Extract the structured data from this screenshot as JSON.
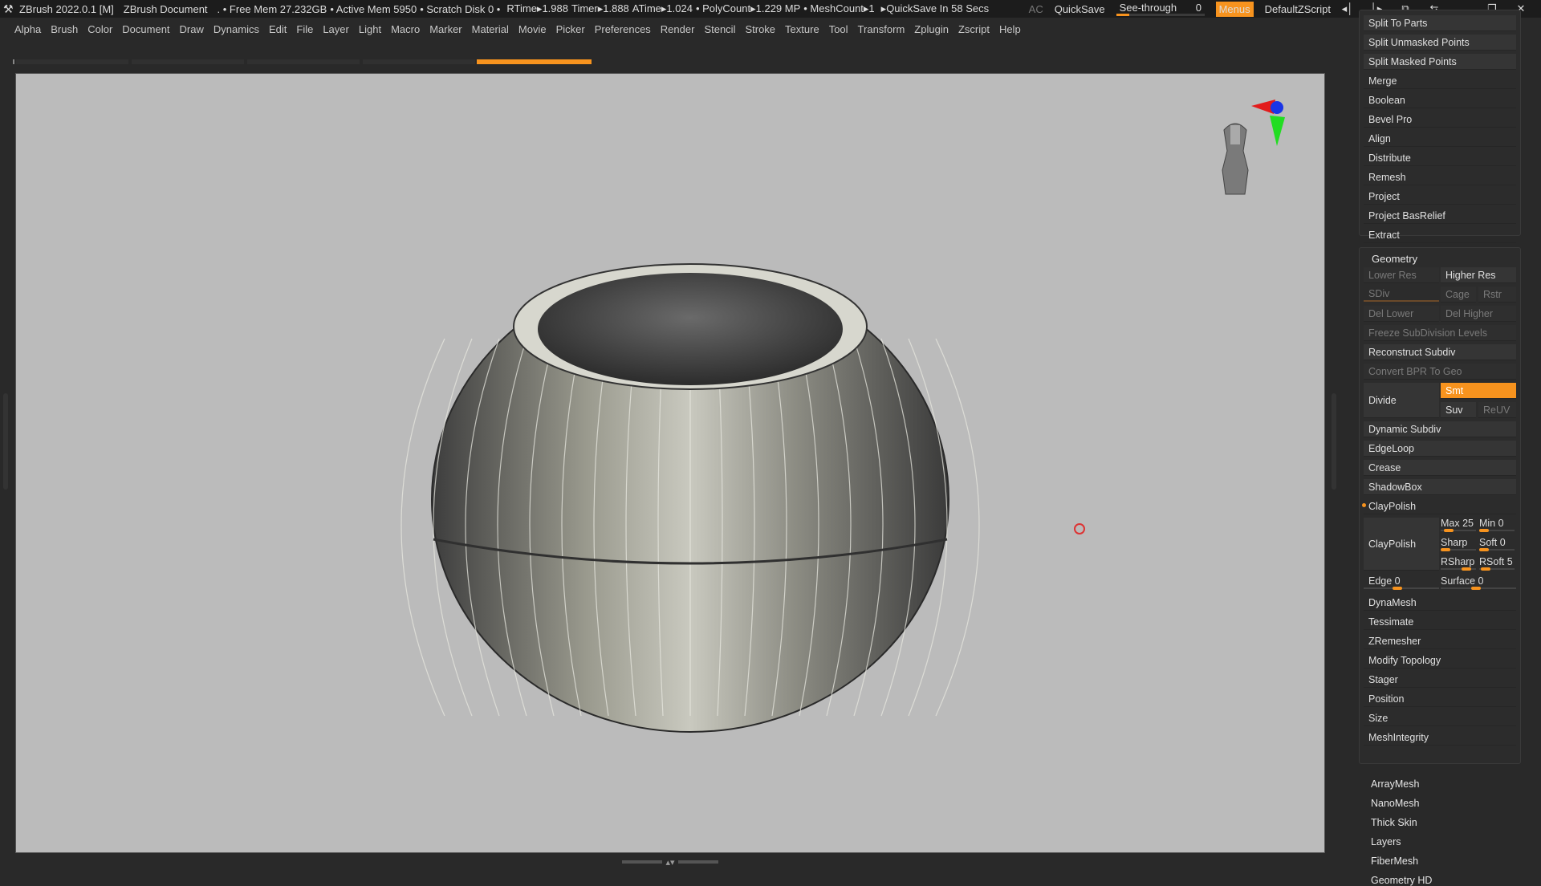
{
  "titlebar": {
    "app": "ZBrush 2022.0.1 [M]",
    "document": "ZBrush Document",
    "free_mem": ". • Free Mem 27.232GB",
    "active_mem": "• Active Mem 5950",
    "scratch": "• Scratch Disk 0 •",
    "rtime": "RTime▸1.988",
    "timer": "Timer▸1.888",
    "atime": "ATime▸1.024",
    "polycount": "• PolyCount▸1.229 MP",
    "meshcount": "• MeshCount▸1",
    "quicksave_in": "▸QuickSave In 58 Secs",
    "ac": "AC",
    "quicksave": "QuickSave",
    "seethrough_label": "See-through",
    "seethrough_value": "0",
    "menus": "Menus",
    "script": "DefaultZScript"
  },
  "menu": [
    "Alpha",
    "Brush",
    "Color",
    "Document",
    "Draw",
    "Dynamics",
    "Edit",
    "File",
    "Layer",
    "Light",
    "Macro",
    "Marker",
    "Material",
    "Movie",
    "Picker",
    "Preferences",
    "Render",
    "Stencil",
    "Stroke",
    "Texture",
    "Tool",
    "Transform",
    "Zplugin",
    "Zscript",
    "Help"
  ],
  "subtool_buttons": [
    "Split To Parts",
    "Split Unmasked Points",
    "Split Masked Points",
    "Merge",
    "Boolean",
    "Bevel Pro",
    "Align",
    "Distribute",
    "Remesh",
    "Project",
    "Project BasRelief",
    "Extract"
  ],
  "geometry": {
    "title": "Geometry",
    "lower_res": "Lower Res",
    "higher_res": "Higher Res",
    "sdiv": "SDiv",
    "cage": "Cage",
    "rstr": "Rstr",
    "del_lower": "Del Lower",
    "del_higher": "Del Higher",
    "freeze": "Freeze SubDivision Levels",
    "reconstruct": "Reconstruct Subdiv",
    "convert_bpr": "Convert BPR To Geo",
    "divide": "Divide",
    "smt": "Smt",
    "suv": "Suv",
    "reuv": "ReUV",
    "dynamic_subdiv": "Dynamic Subdiv",
    "edgeloop": "EdgeLoop",
    "crease": "Crease",
    "shadowbox": "ShadowBox",
    "claypolish_header": "ClayPolish",
    "claypolish_btn": "ClayPolish",
    "max": "Max 25",
    "min": "Min 0",
    "sharp": "Sharp",
    "soft": "Soft 0",
    "rsharp": "RSharp",
    "rsoft": "RSoft 5",
    "edge": "Edge 0",
    "surface": "Surface 0",
    "more": [
      "DynaMesh",
      "Tessimate",
      "ZRemesher",
      "Modify Topology",
      "Stager",
      "Position",
      "Size",
      "MeshIntegrity"
    ]
  },
  "tool_sections": [
    "ArrayMesh",
    "NanoMesh",
    "Thick Skin",
    "Layers",
    "FiberMesh",
    "Geometry HD"
  ],
  "colors": {
    "accent": "#f7931e",
    "viewport_bg": "#bbbbbb",
    "panel_bg": "#292929"
  }
}
